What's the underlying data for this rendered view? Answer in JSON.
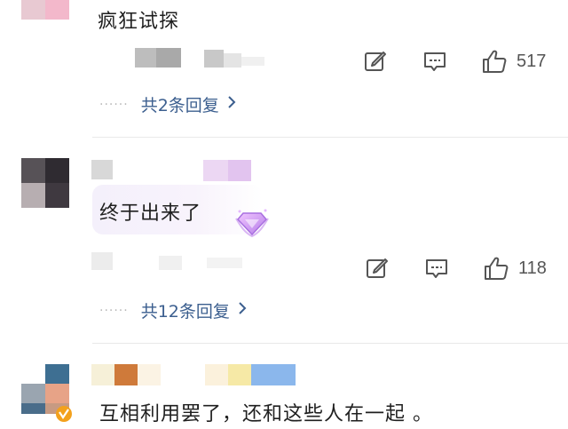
{
  "comments": [
    {
      "text": "疯狂试探",
      "like_count": "517",
      "replies_label": "共2条回复"
    },
    {
      "text": "终于出来了",
      "like_count": "118",
      "replies_label": "共12条回复"
    },
    {
      "text": "互相利用罢了，还和这些人在一起 。"
    }
  ],
  "icons": {
    "edit": "edit-icon",
    "comment": "comment-icon",
    "like": "thumbs-up-icon",
    "chevron": "chevron-right-icon",
    "badge": "diamond-badge-icon",
    "verified": "verified-icon"
  },
  "colors": {
    "link": "#3c5f8f",
    "text": "#1f1f1f",
    "icon": "#555555",
    "divider": "#e9e9e9"
  }
}
